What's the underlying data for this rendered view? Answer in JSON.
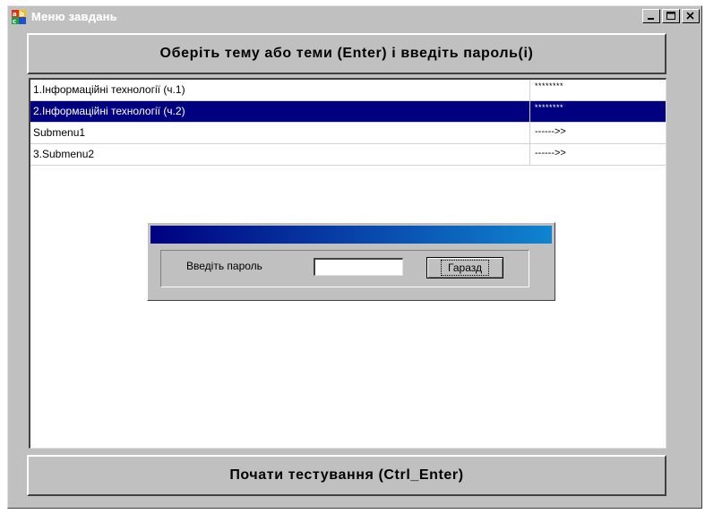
{
  "window": {
    "title": "Меню завдань",
    "icon": "app-icon",
    "controls": {
      "minimize_icon": "minimize-icon",
      "maximize_icon": "maximize-icon",
      "close_icon": "close-icon"
    }
  },
  "header_button": {
    "label": "Оберіть тему або теми (Enter) і введіть пароль(і)"
  },
  "topics": [
    {
      "name": "1.Інформаційні технології (ч.1)",
      "value": "********",
      "selected": false
    },
    {
      "name": "2.Інформаційні технології (ч.2)",
      "value": "********",
      "selected": true
    },
    {
      "name": "Submenu1",
      "value": "------>>",
      "selected": false
    },
    {
      "name": "3.Submenu2",
      "value": "------>>",
      "selected": false
    }
  ],
  "password_dialog": {
    "label": "Введіть пароль",
    "password_value": "",
    "ok_label": "Гаразд"
  },
  "footer_button": {
    "label": "Почати тестування (Ctrl_Enter)"
  },
  "colors": {
    "face": "#c0c0c0",
    "selection": "#000080",
    "dialog_title_start": "#000080",
    "dialog_title_end": "#1084d0"
  }
}
